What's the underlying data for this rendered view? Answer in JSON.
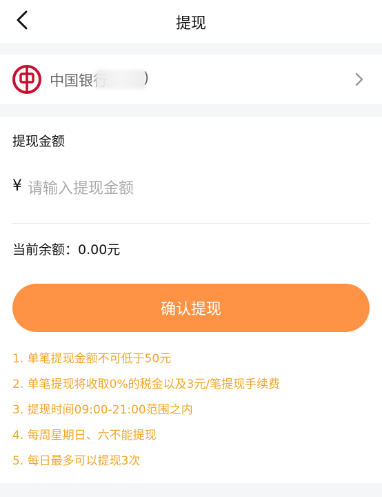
{
  "header": {
    "title": "提现",
    "back_icon": "chevron-left-icon"
  },
  "bank_card": {
    "name": "中国银行",
    "paren": ")",
    "logo_icon": "bank-of-china-logo",
    "logo_color": "#c8102e",
    "arrow_icon": "chevron-right-icon"
  },
  "withdraw": {
    "amount_label": "提现金额",
    "currency_symbol": "¥",
    "amount_value": "",
    "amount_placeholder": "请输入提现金额",
    "balance_text": "当前余额：0.00元",
    "confirm_label": "确认提现",
    "accent_color": "#fe9346"
  },
  "notes": [
    "1. 单笔提现金额不可低于50元",
    "2. 单笔提现将收取0%的税金以及3元/笔提现手续费",
    "3. 提现时间09:00-21:00范围之内",
    "4. 每周星期日、六不能提现",
    "5. 每日最多可以提现3次"
  ],
  "notes_color": "#f3a52b"
}
